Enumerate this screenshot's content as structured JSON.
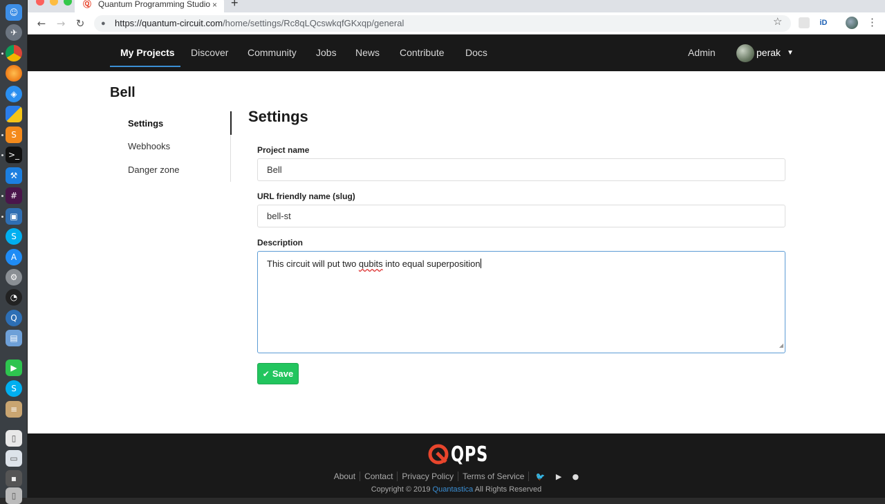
{
  "browser": {
    "tab_title": "Quantum Programming Studio",
    "tab_close": "×",
    "new_tab": "+",
    "url_host": "https://quantum-circuit.com",
    "url_path": "/home/settings/Rc8qLQcswkqfGKxqp/general",
    "back": "←",
    "forward": "→",
    "reload": "↻",
    "lock_icon": "🔒",
    "star": "☆",
    "ext_id": "iD",
    "menu": "⋮"
  },
  "nav": {
    "items": [
      "My Projects",
      "Discover",
      "Community",
      "Jobs",
      "News",
      "Contribute",
      "Docs"
    ],
    "admin": "Admin",
    "username": "perak",
    "caret": "▼"
  },
  "project": {
    "title": "Bell"
  },
  "sidebar": {
    "items": [
      "Settings",
      "Webhooks",
      "Danger zone"
    ]
  },
  "settings": {
    "heading": "Settings",
    "project_name_label": "Project name",
    "project_name_value": "Bell",
    "slug_label": "URL friendly name (slug)",
    "slug_value": "bell-st",
    "description_label": "Description",
    "description_pre": "This circuit will put two ",
    "description_misspelled": "qubits",
    "description_post": " into equal superposition",
    "save_label": "Save",
    "save_icon": "✔"
  },
  "footer": {
    "logo_text": "QPS",
    "links": [
      "About",
      "Contact",
      "Privacy Policy",
      "Terms of Service"
    ],
    "social": [
      "twitter-icon",
      "youtube-icon",
      "github-icon"
    ],
    "copyright_pre": "Copyright © 2019 ",
    "copyright_brand": "Quantastica",
    "copyright_post": " All Rights Reserved"
  },
  "colors": {
    "accent": "#3b8fd4",
    "save_green": "#22c55e",
    "nav_bg": "#191919"
  }
}
